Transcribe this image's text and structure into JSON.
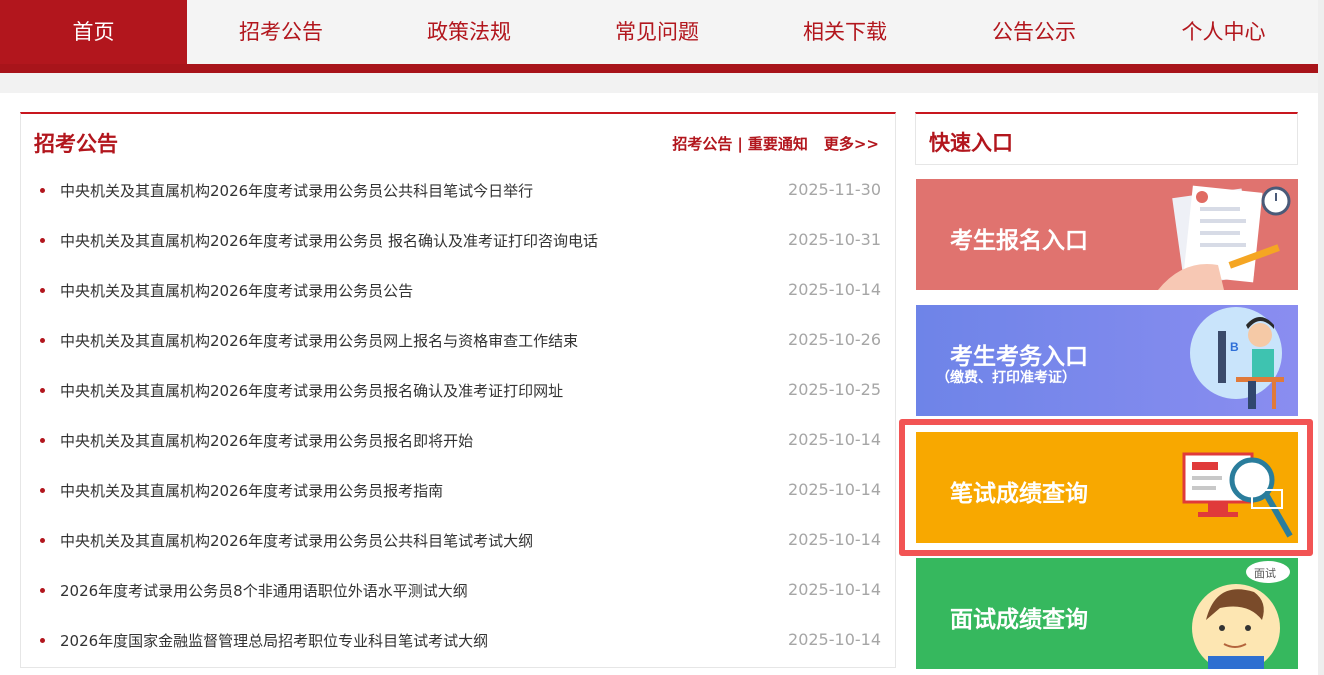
{
  "nav": {
    "items": [
      {
        "label": "首页",
        "active": true
      },
      {
        "label": "招考公告",
        "active": false
      },
      {
        "label": "政策法规",
        "active": false
      },
      {
        "label": "常见问题",
        "active": false
      },
      {
        "label": "相关下载",
        "active": false
      },
      {
        "label": "公告公示",
        "active": false
      },
      {
        "label": "个人中心",
        "active": false
      }
    ]
  },
  "announcements": {
    "title": "招考公告",
    "links": {
      "recruit": "招考公告",
      "separator": "|",
      "notice": "重要通知",
      "more": "更多>>"
    },
    "items": [
      {
        "title": "中央机关及其直属机构2026年度考试录用公务员公共科目笔试今日举行",
        "date": "2025-11-30"
      },
      {
        "title": "中央机关及其直属机构2026年度考试录用公务员 报名确认及准考证打印咨询电话",
        "date": "2025-10-31"
      },
      {
        "title": "中央机关及其直属机构2026年度考试录用公务员公告",
        "date": "2025-10-14"
      },
      {
        "title": "中央机关及其直属机构2026年度考试录用公务员网上报名与资格审查工作结束",
        "date": "2025-10-26"
      },
      {
        "title": "中央机关及其直属机构2026年度考试录用公务员报名确认及准考证打印网址",
        "date": "2025-10-25"
      },
      {
        "title": "中央机关及其直属机构2026年度考试录用公务员报名即将开始",
        "date": "2025-10-14"
      },
      {
        "title": "中央机关及其直属机构2026年度考试录用公务员报考指南",
        "date": "2025-10-14"
      },
      {
        "title": "中央机关及其直属机构2026年度考试录用公务员公共科目笔试考试大纲",
        "date": "2025-10-14"
      },
      {
        "title": "2026年度考试录用公务员8个非通用语职位外语水平测试大纲",
        "date": "2025-10-14"
      },
      {
        "title": "2026年度国家金融监督管理总局招考职位专业科目笔试考试大纲",
        "date": "2025-10-14"
      }
    ]
  },
  "quick_entry": {
    "title": "快速入口",
    "cards": [
      {
        "label": "考生报名入口",
        "icon": "registration-form-icon"
      },
      {
        "label": "考生考务入口",
        "sub": "（缴费、打印准考证）",
        "icon": "student-at-computer-icon"
      },
      {
        "label": "笔试成绩查询",
        "icon": "magnifier-screen-icon"
      },
      {
        "label": "面试成绩查询",
        "icon": "interviewee-avatar-icon",
        "badge": "面试"
      }
    ]
  },
  "colors": {
    "brand_red": "#b2161d",
    "card_register": "#e0736f",
    "card_affairs": "#7b88ec",
    "card_written": "#f8a800",
    "card_interview": "#36b85e",
    "highlight": "#f25454"
  }
}
